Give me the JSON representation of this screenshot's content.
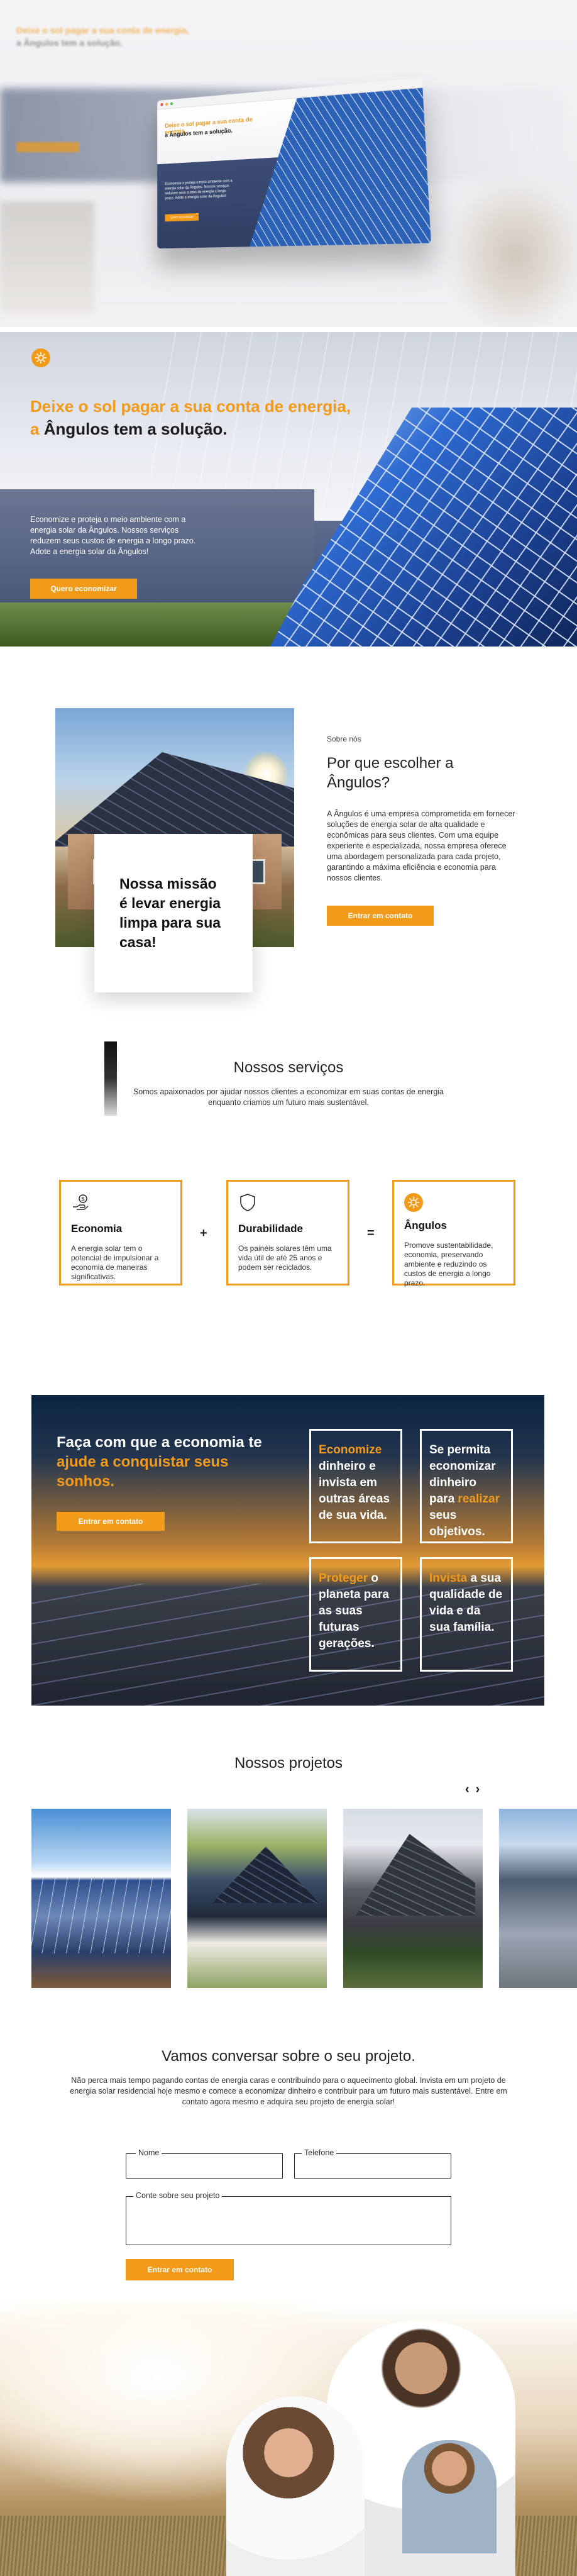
{
  "mockup": {
    "blur_line1": "Deixe o sol pagar a sua conta de energia,",
    "blur_line2": "a Ângulos tem a solução.",
    "screen_title1": "Deixe o sol pagar a sua conta de energia,",
    "screen_title2": "a Ângulos tem a solução.",
    "screen_text": "Economize e proteja o meio ambiente com a energia solar da Ângulos. Nossos serviços reduzem seus custos de energia a longo prazo. Adote a energia solar da Ângulos!",
    "screen_button": "Quero economizar"
  },
  "hero": {
    "logo_icon": "sun-icon",
    "title_orange": "Deixe o sol pagar a sua conta de energia,",
    "title_prefix": "a",
    "title_dark": "Ângulos tem a solução.",
    "text": "Economize e proteja o meio ambiente com a energia solar da Ângulos. Nossos serviços reduzem seus custos de energia a longo prazo. Adote a energia solar da Ângulos!",
    "button": "Quero economizar"
  },
  "about": {
    "mission": "Nossa missão é levar energia limpa para sua casa!",
    "kicker": "Sobre nós",
    "title": "Por que escolher a Ângulos?",
    "description": "A Ângulos é uma empresa comprometida em fornecer soluções de energia solar de alta qualidade e econômicas para seus clientes. Com uma equipe experiente e especializada, nossa empresa oferece uma abordagem personalizada para cada projeto, garantindo a máxima eficiência e economia para nossos clientes.",
    "button": "Entrar em contato"
  },
  "services": {
    "title": "Nossos serviços",
    "subtitle": "Somos apaixonados por ajudar nossos clientes a economizar em suas contas de energia enquanto criamos um futuro mais sustentável.",
    "items": [
      {
        "icon": "money-hand-icon",
        "title": "Economia",
        "text": "A energia solar tem o potencial de impulsionar a economia de maneiras significativas."
      },
      {
        "icon": "shield-icon",
        "title": "Durabilidade",
        "text": "Os painéis solares têm uma vida útil de até 25 anos e podem ser reciclados."
      },
      {
        "icon": "sun-icon",
        "title": "Ângulos",
        "text": "Promove sustentabilidade, economia, preservando ambiente e reduzindo os custos de energia a longo prazo."
      }
    ],
    "plus": "+",
    "equals": "="
  },
  "cta": {
    "title_a": "Faça com que a economia te",
    "title_b": "ajude a conquistar seus sonhos.",
    "button": "Entrar em contato",
    "boxes": [
      {
        "orange": "Economize",
        "white": "dinheiro e invista em outras áreas de sua vida."
      },
      {
        "w1": "Se permita economizar dinheiro para",
        "orange": "realizar",
        "w2": "seus objetivos."
      },
      {
        "orange": "Proteger",
        "white": "o planeta para as suas futuras gerações."
      },
      {
        "orange": "Invista",
        "white": "a sua qualidade de vida e da sua família."
      }
    ]
  },
  "projects": {
    "title": "Nossos projetos",
    "prev": "‹",
    "next": "›"
  },
  "contact": {
    "title": "Vamos conversar sobre o seu projeto.",
    "text": "Não perca mais tempo pagando contas de energia caras e contribuindo para o aquecimento global. Invista em um projeto de energia solar residencial hoje mesmo e comece a economizar dinheiro e contribuir para um futuro mais sustentável. Entre em contato agora mesmo e adquira seu projeto de energia solar!",
    "name_label": "Nome",
    "phone_label": "Telefone",
    "message_label": "Conte sobre seu projeto",
    "button": "Entrar em contato"
  },
  "colors": {
    "accent": "#f29a1a",
    "dark": "#222222"
  }
}
